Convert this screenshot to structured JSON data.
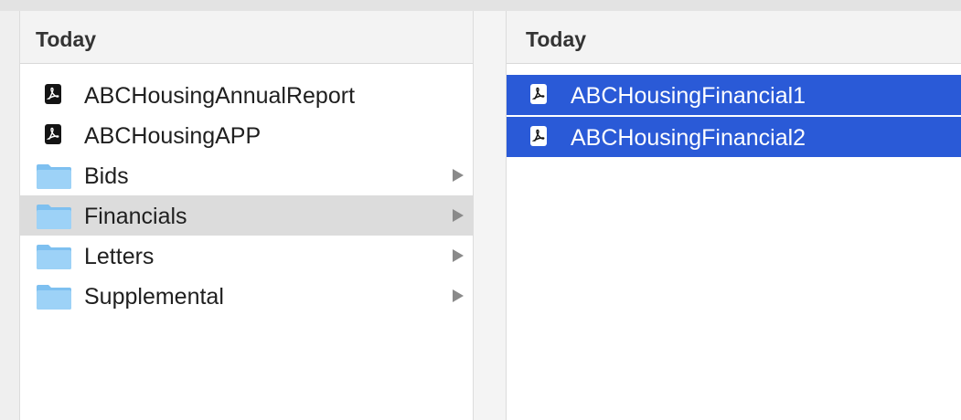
{
  "colors": {
    "selection_gray": "#dcdcdc",
    "selection_blue": "#2a5ad7",
    "folder_blue": "#8cc8f4",
    "pdf_icon": "#141414"
  },
  "left_column": {
    "header": "Today",
    "items": [
      {
        "label": "ABCHousingAnnualReport",
        "icon": "pdf-icon"
      },
      {
        "label": "ABCHousingAPP",
        "icon": "pdf-icon"
      },
      {
        "label": "Bids",
        "icon": "folder-icon"
      },
      {
        "label": "Financials",
        "icon": "folder-icon",
        "selected": true
      },
      {
        "label": "Letters",
        "icon": "folder-icon"
      },
      {
        "label": "Supplemental",
        "icon": "folder-icon"
      }
    ]
  },
  "right_column": {
    "header": "Today",
    "items": [
      {
        "label": "ABCHousingFinancial1",
        "icon": "pdf-icon",
        "selected": true
      },
      {
        "label": "ABCHousingFinancial2",
        "icon": "pdf-icon",
        "selected": true
      }
    ]
  }
}
